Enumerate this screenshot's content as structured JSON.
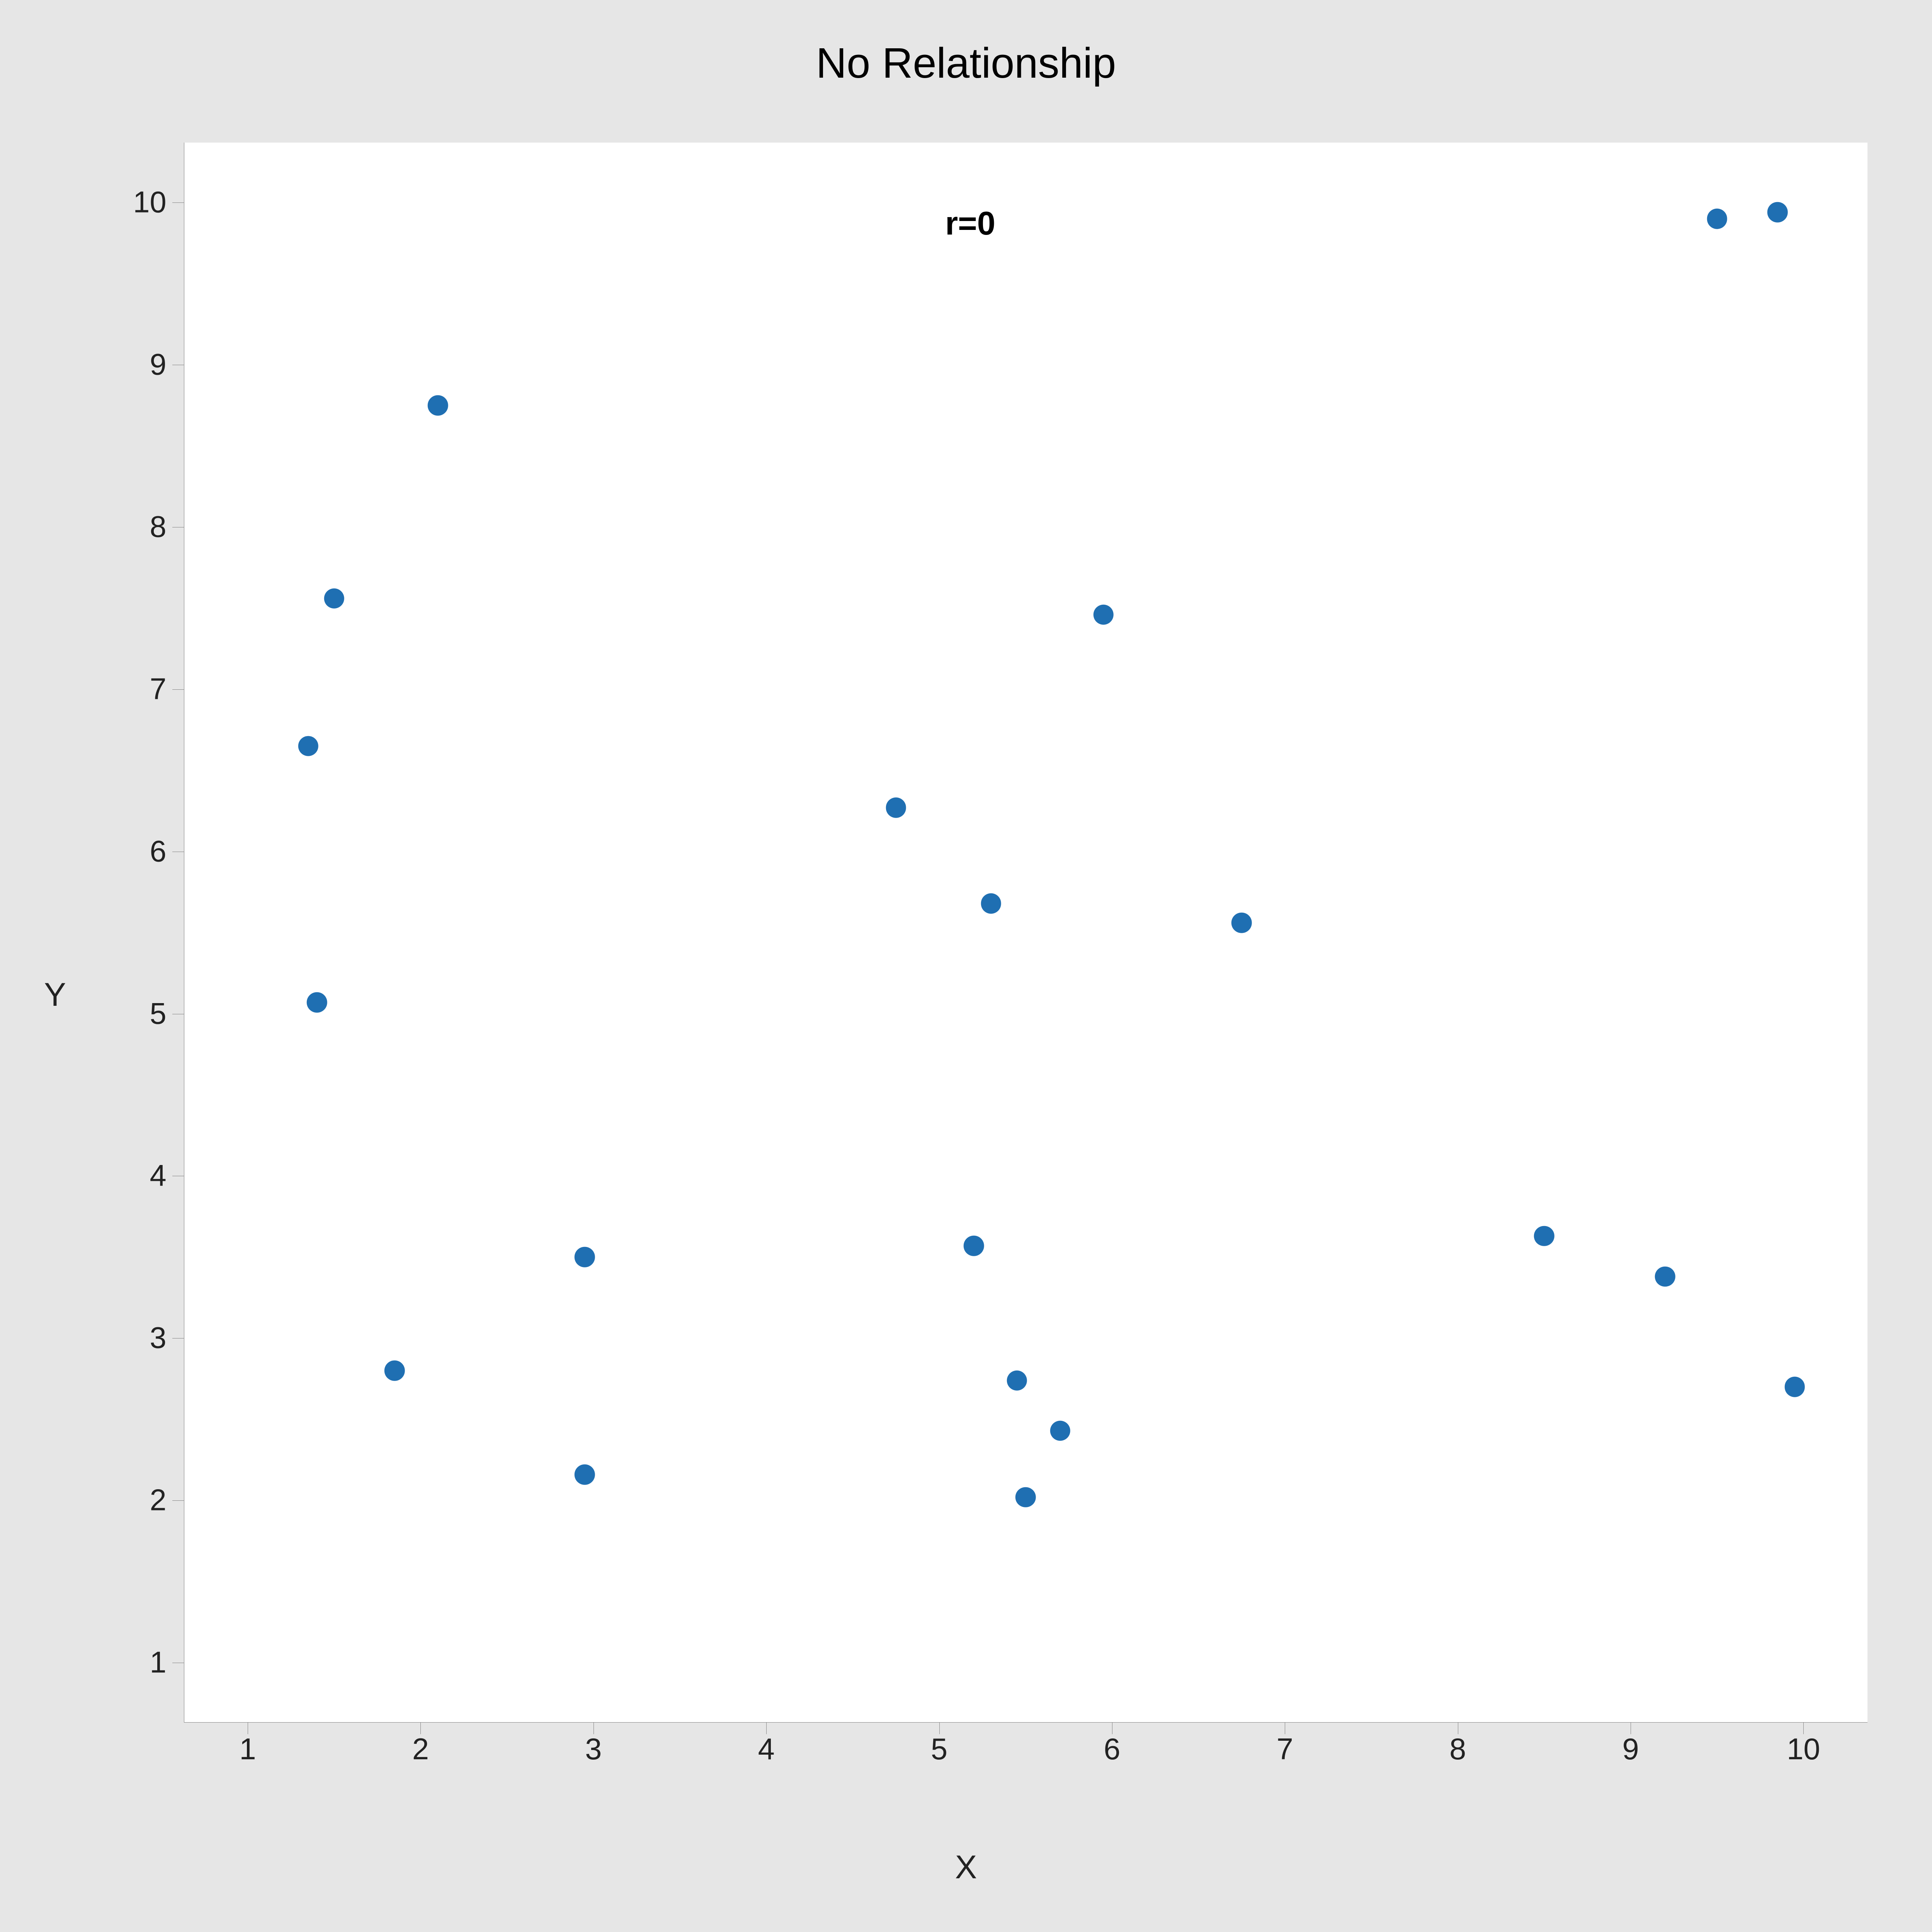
{
  "chart_data": {
    "type": "scatter",
    "title": "No Relationship",
    "xlabel": "X",
    "ylabel": "Y",
    "annotation": "r=0",
    "annotation_xy": [
      5.18,
      9.87
    ],
    "xlim": [
      0.63,
      10.37
    ],
    "ylim": [
      0.63,
      10.37
    ],
    "x_ticks": [
      1,
      2,
      3,
      4,
      5,
      6,
      7,
      8,
      9,
      10
    ],
    "y_ticks": [
      1,
      2,
      3,
      4,
      5,
      6,
      7,
      8,
      9,
      10
    ],
    "points": [
      {
        "x": 1.35,
        "y": 6.65
      },
      {
        "x": 1.4,
        "y": 5.07
      },
      {
        "x": 1.5,
        "y": 7.56
      },
      {
        "x": 1.85,
        "y": 2.8
      },
      {
        "x": 2.1,
        "y": 8.75
      },
      {
        "x": 2.95,
        "y": 3.5
      },
      {
        "x": 2.95,
        "y": 2.16
      },
      {
        "x": 4.75,
        "y": 6.27
      },
      {
        "x": 5.2,
        "y": 3.57
      },
      {
        "x": 5.3,
        "y": 5.68
      },
      {
        "x": 5.45,
        "y": 2.74
      },
      {
        "x": 5.5,
        "y": 2.02
      },
      {
        "x": 5.7,
        "y": 2.43
      },
      {
        "x": 5.95,
        "y": 7.46
      },
      {
        "x": 6.75,
        "y": 5.56
      },
      {
        "x": 8.5,
        "y": 3.63
      },
      {
        "x": 9.2,
        "y": 3.38
      },
      {
        "x": 9.5,
        "y": 9.9
      },
      {
        "x": 9.85,
        "y": 9.94
      },
      {
        "x": 9.95,
        "y": 2.7
      }
    ]
  }
}
